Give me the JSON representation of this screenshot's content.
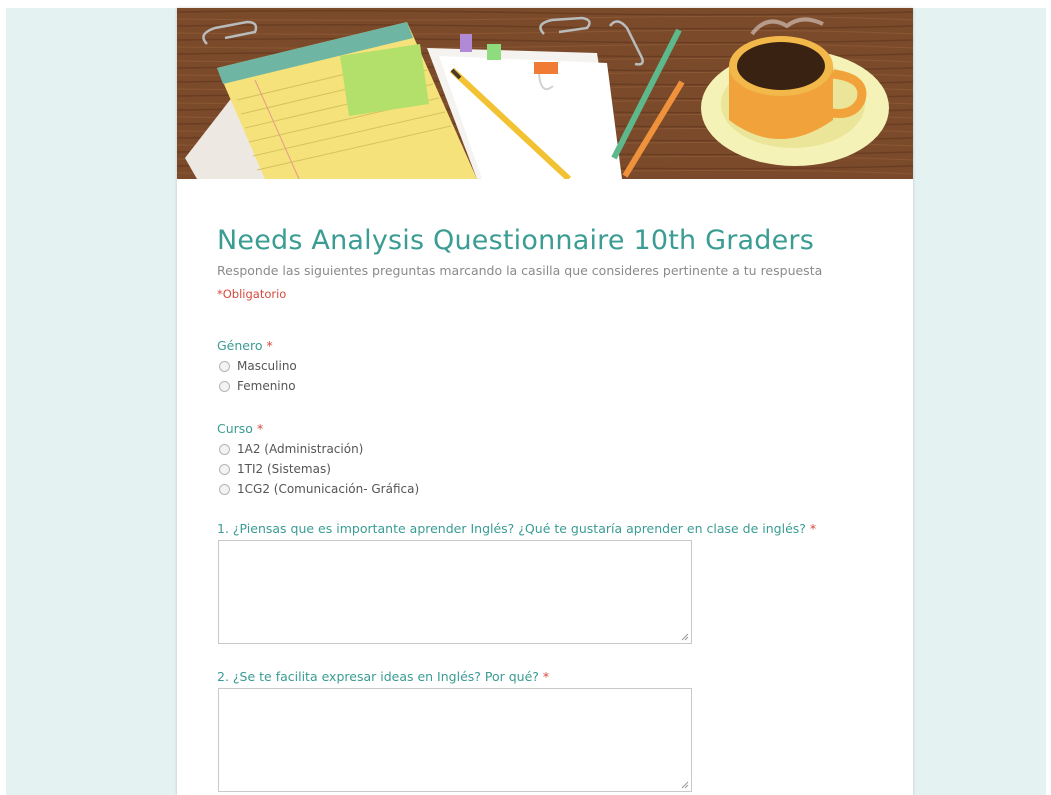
{
  "form": {
    "title": "Needs Analysis Questionnaire 10th Graders",
    "description": "Responde las siguientes preguntas marcando la casilla que consideres pertinente a tu respuesta",
    "required_note": "*Obligatorio"
  },
  "questions": [
    {
      "title": "Género",
      "required_mark": "*",
      "type": "radio",
      "options": [
        "Masculino",
        "Femenino"
      ]
    },
    {
      "title": "Curso",
      "required_mark": "*",
      "type": "radio",
      "options": [
        "1A2 (Administración)",
        "1TI2 (Sistemas)",
        "1CG2 (Comunicación- Gráfica)"
      ]
    },
    {
      "title": "1. ¿Piensas que es importante aprender Inglés? ¿Qué te gustaría aprender en clase de inglés?",
      "required_mark": "*",
      "type": "paragraph",
      "value": ""
    },
    {
      "title": "2. ¿Se te facilita expresar ideas en Inglés? Por qué?",
      "required_mark": "*",
      "type": "paragraph",
      "value": ""
    }
  ],
  "colors": {
    "accent": "#3a9c93",
    "required": "#d64a3d",
    "page_background": "#e5f2f2"
  },
  "header_image": "desk-illustration-coffee-notepad-pencils"
}
